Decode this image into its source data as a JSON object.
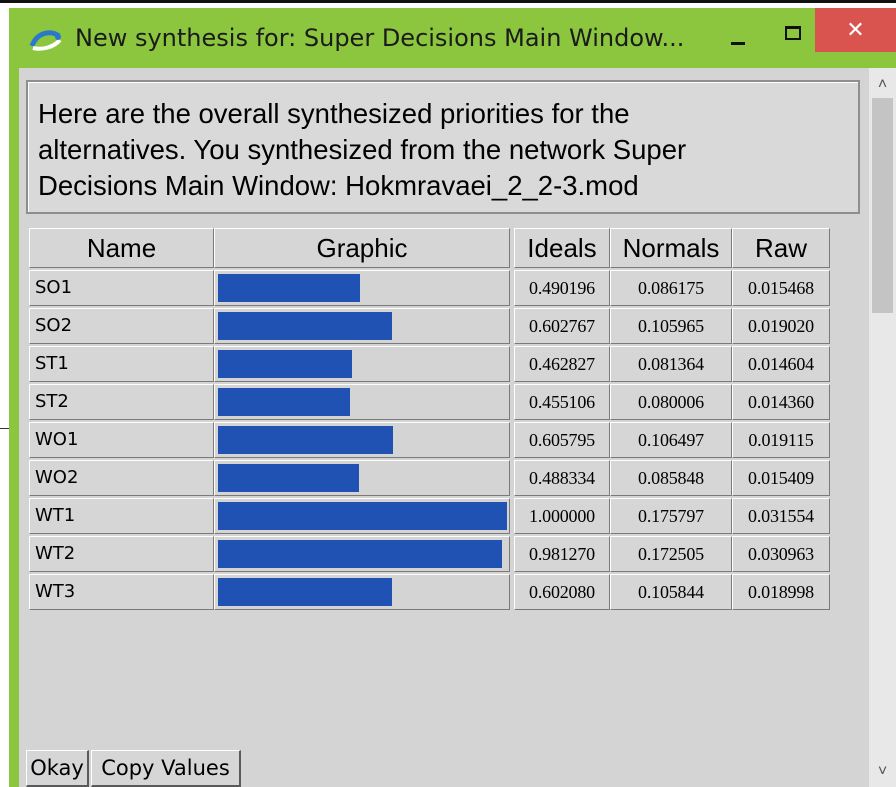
{
  "window": {
    "title": "New synthesis for: Super Decisions Main Window...",
    "minimize_glyph": "",
    "close_glyph": "✕"
  },
  "message": "Here are the overall synthesized priorities for the\nalternatives.  You synthesized from the network Super\nDecisions Main Window: Hokmravaei_2_2-3.mod",
  "table": {
    "headers": {
      "name": "Name",
      "graphic": "Graphic",
      "ideals": "Ideals",
      "normals": "Normals",
      "raw": "Raw"
    },
    "rows": [
      {
        "name": "SO1",
        "ideal": "0.490196",
        "normal": "0.086175",
        "raw": "0.015468",
        "bar_fraction": 0.490196
      },
      {
        "name": "SO2",
        "ideal": "0.602767",
        "normal": "0.105965",
        "raw": "0.019020",
        "bar_fraction": 0.602767
      },
      {
        "name": "ST1",
        "ideal": "0.462827",
        "normal": "0.081364",
        "raw": "0.014604",
        "bar_fraction": 0.462827
      },
      {
        "name": "ST2",
        "ideal": "0.455106",
        "normal": "0.080006",
        "raw": "0.014360",
        "bar_fraction": 0.455106
      },
      {
        "name": "WO1",
        "ideal": "0.605795",
        "normal": "0.106497",
        "raw": "0.019115",
        "bar_fraction": 0.605795
      },
      {
        "name": "WO2",
        "ideal": "0.488334",
        "normal": "0.085848",
        "raw": "0.015409",
        "bar_fraction": 0.488334
      },
      {
        "name": "WT1",
        "ideal": "1.000000",
        "normal": "0.175797",
        "raw": "0.031554",
        "bar_fraction": 1.0
      },
      {
        "name": "WT2",
        "ideal": "0.981270",
        "normal": "0.172505",
        "raw": "0.030963",
        "bar_fraction": 0.98127
      },
      {
        "name": "WT3",
        "ideal": "0.602080",
        "normal": "0.105844",
        "raw": "0.018998",
        "bar_fraction": 0.60208
      }
    ]
  },
  "buttons": {
    "okay": "Okay",
    "copy_values": "Copy Values"
  },
  "scrollbar": {
    "up_glyph": "˄",
    "down_glyph": "˅"
  },
  "colors": {
    "titlebar": "#8cc63f",
    "close": "#d9534f",
    "bar": "#1f52b2"
  }
}
